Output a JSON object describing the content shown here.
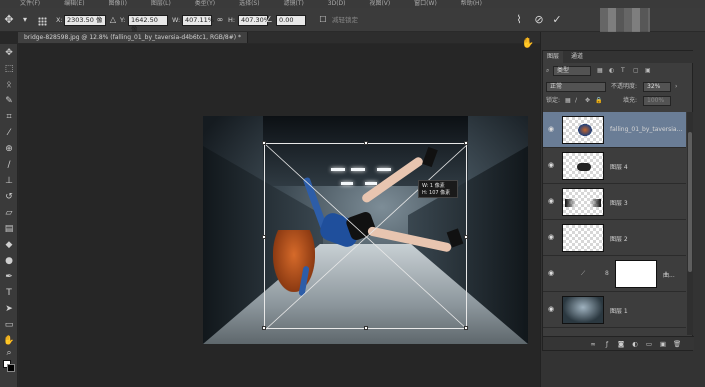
{
  "menubar": {
    "items": [
      "文件(F)",
      "编辑(E)",
      "图像(I)",
      "图层(L)",
      "类型(Y)",
      "选择(S)",
      "滤镜(T)",
      "3D(D)",
      "视图(V)",
      "窗口(W)",
      "帮助(H)"
    ]
  },
  "options_bar": {
    "x_label": "X:",
    "x_value": "2303.50 像",
    "y_label": "Y:",
    "y_value": "1642.50 像",
    "w_label": "W:",
    "w_value": "407.11%",
    "h_label": "H:",
    "h_value": "407.30%",
    "angle_value": "0.00",
    "interp_label": "减轻锁定"
  },
  "document_tab": {
    "title": "bridge-828598.jpg @ 12.8% (falling_01_by_taversia-d4b6tc1, RGB/8#) *"
  },
  "transform_tip": {
    "line1": "W: 1 像素",
    "line2": "H: 107 像素"
  },
  "layers_panel": {
    "tabs": [
      "图层",
      "通道"
    ],
    "kind_filter": "类型",
    "blend_mode": "正常",
    "opacity_label": "不透明度:",
    "opacity_value": "32%",
    "lock_label": "锁定:",
    "fill_label": "填充:",
    "fill_value": "100%",
    "layers": [
      {
        "name": "falling_01_by_taversia...",
        "active": true
      },
      {
        "name": "图层 4",
        "active": false
      },
      {
        "name": "图层 3",
        "active": false
      },
      {
        "name": "图层 2",
        "active": false
      },
      {
        "name": "曲...",
        "active": false
      },
      {
        "name": "图层 1",
        "active": false
      }
    ]
  },
  "colors": {
    "accent_selection": "#6a7d96",
    "panel_bg": "#3d3d3d",
    "app_bg": "#282828"
  }
}
